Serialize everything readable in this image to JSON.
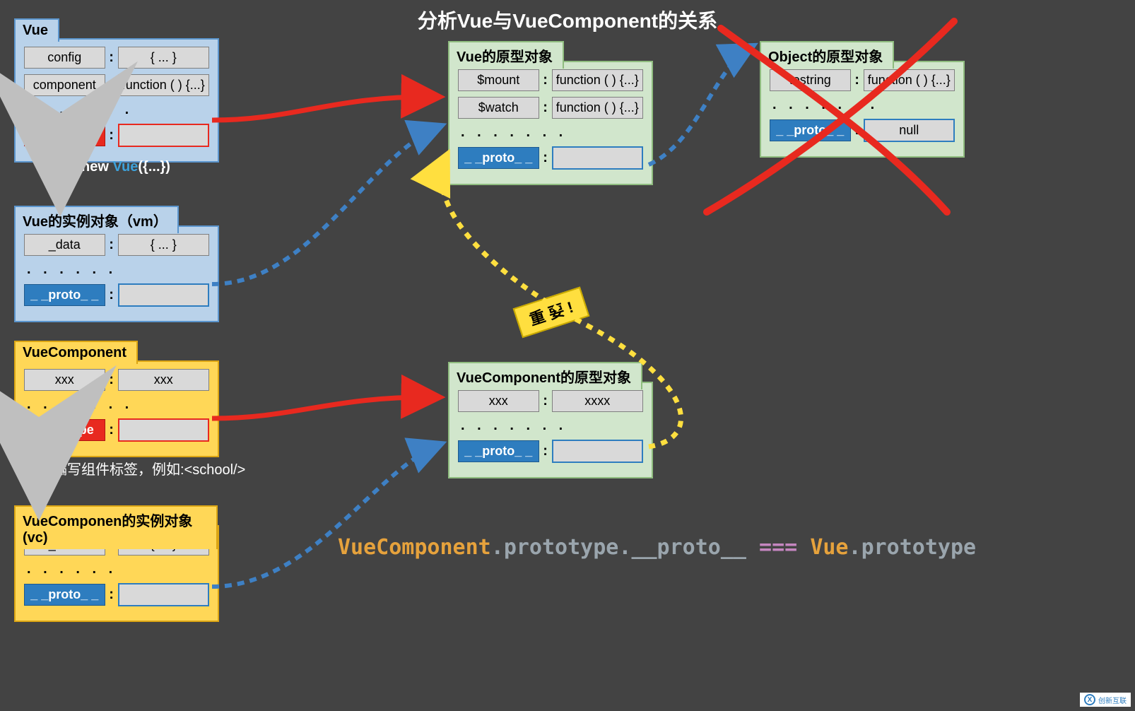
{
  "title": "分析Vue与VueComponent的关系",
  "vue_box": {
    "header": "Vue",
    "rows": [
      {
        "key": "config",
        "val": "{ ... }"
      },
      {
        "key": "component",
        "val": "function ( ) {...}"
      }
    ],
    "dots": ". . . . . . .",
    "proto_key": "prototype"
  },
  "vue_proto_box": {
    "header": "Vue的原型对象",
    "rows": [
      {
        "key": "$mount",
        "val": "function ( ) {...}"
      },
      {
        "key": "$watch",
        "val": "function ( ) {...}"
      }
    ],
    "dots": ". . . . . . .",
    "proto_key": "_ _proto_ _"
  },
  "object_proto_box": {
    "header": "Object的原型对象",
    "rows": [
      {
        "key": "tostring",
        "val": "function ( ) {...}"
      }
    ],
    "dots": ". . . . . . .",
    "proto_key": "_ _proto_ _",
    "proto_val": "null"
  },
  "vm_box": {
    "header": "Vue的实例对象（vm）",
    "rows": [
      {
        "key": "_data",
        "val": "{ ... }"
      }
    ],
    "dots": ". . . . . .",
    "proto_key": "_ _proto_ _"
  },
  "vc_ctor_box": {
    "header": "VueComponent",
    "rows": [
      {
        "key": "xxx",
        "val": "xxx"
      }
    ],
    "dots": ". . . . . . .",
    "proto_key": "prototype"
  },
  "vc_proto_box": {
    "header": "VueComponent的原型对象",
    "rows": [
      {
        "key": "xxx",
        "val": "xxxx"
      }
    ],
    "dots": ". . . . . . .",
    "proto_key": "_ _proto_ _"
  },
  "vc_inst_box": {
    "header": "VueComponen的实例对象(vc)",
    "rows": [
      {
        "key": "_data",
        "val": "{ ... }"
      }
    ],
    "dots": ". . . . . .",
    "proto_key": "_ _proto_ _"
  },
  "labels": {
    "new_vue_pre": "new ",
    "new_vue_mid": "Vue",
    "new_vue_post": "({...})",
    "write_tag": "编写组件标签，例如:<school/>",
    "important": "重 要 !"
  },
  "code": {
    "part1": "VueComponent",
    "dot": ".",
    "part2": "prototype",
    "part3": "__proto__",
    "eq": " === ",
    "part4": "Vue",
    "part5": "prototype"
  },
  "watermark": {
    "sym": "X",
    "text": "创新互联"
  },
  "chart_data": {
    "type": "diagram",
    "title": "分析Vue与VueComponent的关系",
    "nodes": [
      {
        "id": "Vue",
        "kind": "constructor",
        "props": [
          "config",
          "component",
          "prototype"
        ]
      },
      {
        "id": "VuePrototype",
        "kind": "prototype",
        "label": "Vue的原型对象",
        "props": [
          "$mount",
          "$watch",
          "__proto__"
        ]
      },
      {
        "id": "ObjectPrototype",
        "kind": "prototype",
        "label": "Object的原型对象",
        "props": [
          "tostring",
          "__proto__=null"
        ],
        "crossed_out": true
      },
      {
        "id": "vm",
        "kind": "instance",
        "label": "Vue的实例对象（vm）",
        "props": [
          "_data",
          "__proto__"
        ]
      },
      {
        "id": "VueComponent",
        "kind": "constructor",
        "props": [
          "xxx",
          "prototype"
        ]
      },
      {
        "id": "VueComponentPrototype",
        "kind": "prototype",
        "label": "VueComponent的原型对象",
        "props": [
          "xxx",
          "__proto__"
        ]
      },
      {
        "id": "vc",
        "kind": "instance",
        "label": "VueComponen的实例对象(vc)",
        "props": [
          "_data",
          "__proto__"
        ]
      }
    ],
    "edges": [
      {
        "from": "Vue",
        "to": "vm",
        "label": "new Vue({...})",
        "style": "step"
      },
      {
        "from": "Vue.prototype",
        "to": "VuePrototype",
        "style": "solid-red"
      },
      {
        "from": "vm.__proto__",
        "to": "VuePrototype",
        "style": "dashed-blue"
      },
      {
        "from": "VuePrototype.__proto__",
        "to": "ObjectPrototype",
        "style": "dashed-blue"
      },
      {
        "from": "VueComponent",
        "to": "vc",
        "label": "编写组件标签，例如:<school/>",
        "style": "step"
      },
      {
        "from": "VueComponent.prototype",
        "to": "VueComponentPrototype",
        "style": "solid-red"
      },
      {
        "from": "vc.__proto__",
        "to": "VueComponentPrototype",
        "style": "dashed-blue"
      },
      {
        "from": "VueComponentPrototype.__proto__",
        "to": "VuePrototype",
        "style": "dashed-yellow",
        "label": "重要!"
      }
    ],
    "equation": "VueComponent.prototype.__proto__ === Vue.prototype"
  }
}
